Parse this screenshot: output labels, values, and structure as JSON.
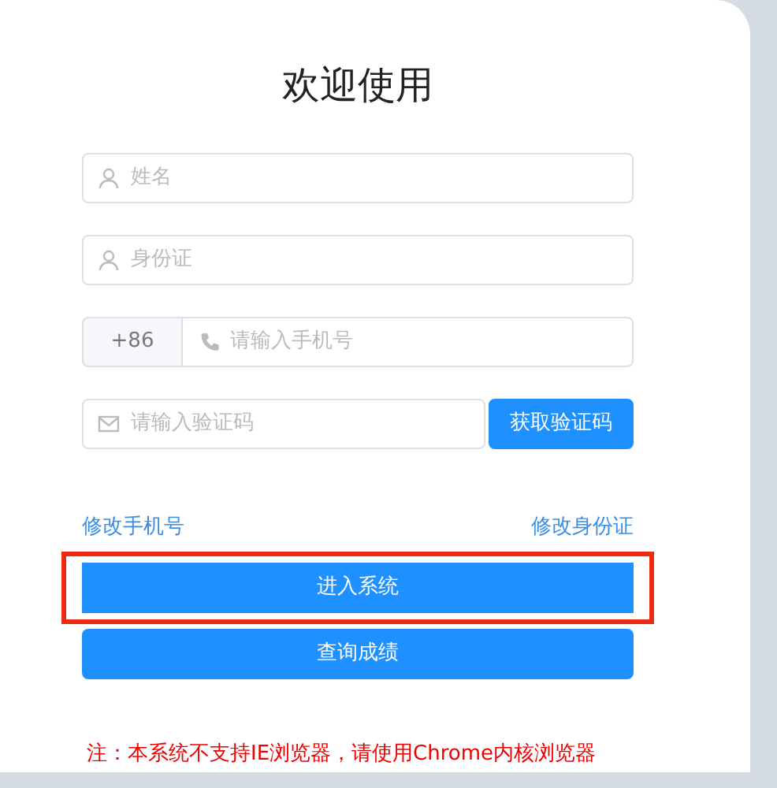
{
  "title": "欢迎使用",
  "fields": [
    {
      "kind": "user",
      "placeholder": "姓名"
    },
    {
      "kind": "user",
      "placeholder": "身份证"
    },
    {
      "kind": "phone",
      "prefix": "+86",
      "placeholder": "请输入手机号"
    },
    {
      "kind": "code",
      "placeholder": "请输入验证码",
      "button": "获取验证码"
    }
  ],
  "links": [
    "修改手机号",
    "修改身份证"
  ],
  "buttons": [
    {
      "label": "进入系统",
      "highlighted": true
    },
    {
      "label": "查询成绩",
      "highlighted": false
    }
  ],
  "notice": "注：本系统不支持IE浏览器，请使用Chrome内核浏览器"
}
